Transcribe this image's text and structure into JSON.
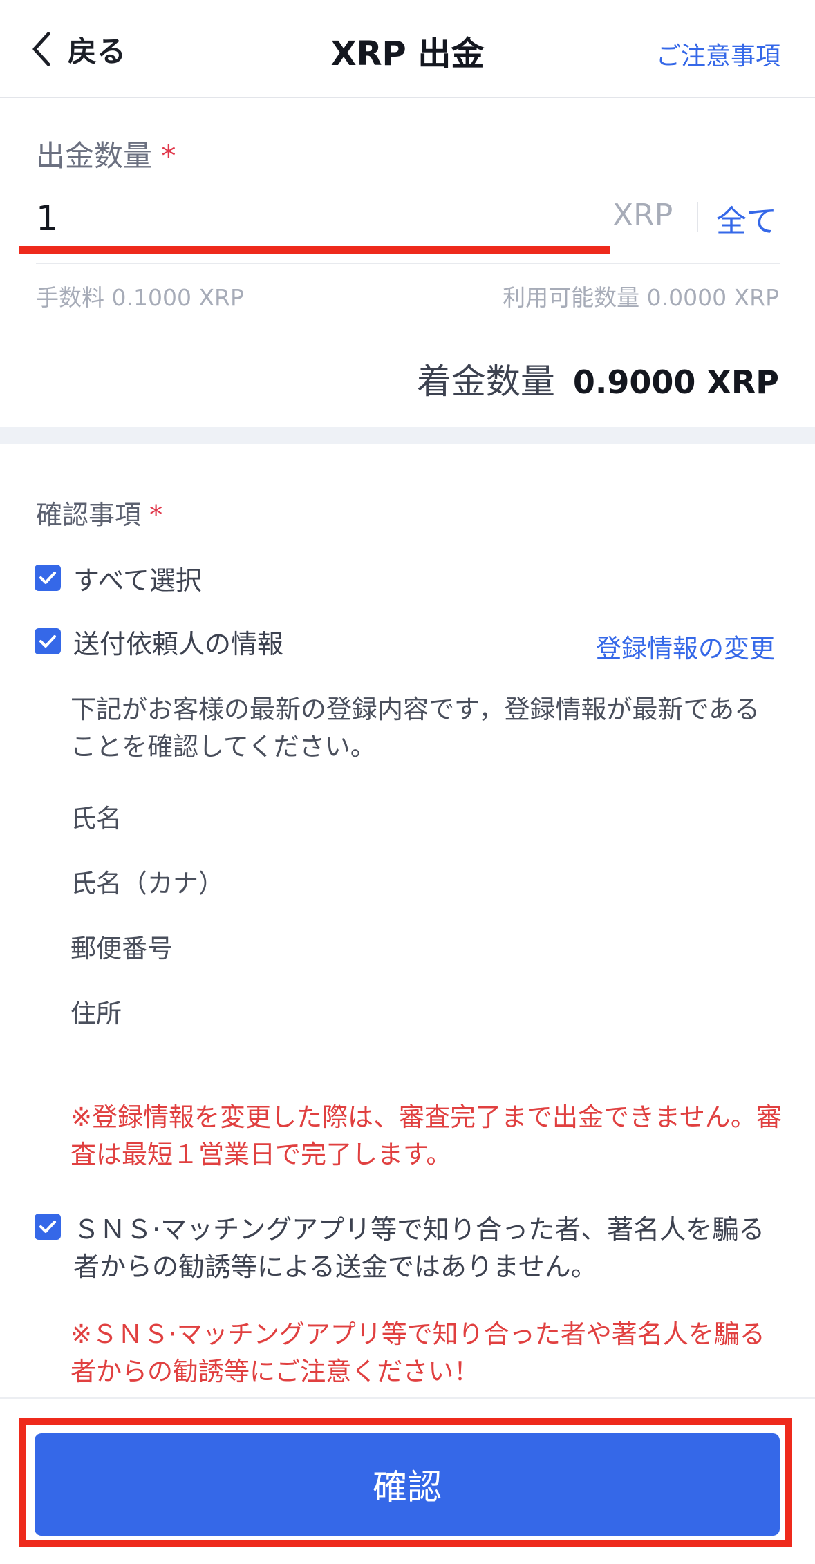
{
  "header": {
    "back_label": "戻る",
    "title": "XRP 出金",
    "notice_link": "ご注意事項"
  },
  "amount": {
    "label": "出金数量",
    "required_mark": "*",
    "value": "1",
    "unit": "XRP",
    "all_button": "全て",
    "fee": "手数料 0.1000 XRP",
    "available": "利用可能数量 0.0000 XRP",
    "receive_label": "着金数量",
    "receive_value": "0.9000 XRP"
  },
  "confirmation": {
    "label": "確認事項",
    "required_mark": "*",
    "select_all": "すべて選択",
    "sender_info": "送付依頼人の情報",
    "change_link": "登録情報の変更",
    "description": "下記がお客様の最新の登録内容です，登録情報が最新であることを確認してください。",
    "fields": [
      "氏名",
      "氏名（カナ）",
      "郵便番号",
      "住所"
    ],
    "warning_1": "※登録情報を変更した際は、審査完了まで出金できません。審査は最短１営業日で完了します。",
    "sns_check": "ＳＮＳ·マッチングアプリ等で知り合った者、著名人を騙る者からの勧誘等による送金ではありません。",
    "warning_2": "※ＳＮＳ·マッチングアプリ等で知り合った者や著名人を騙る者からの勧誘等にご注意ください！"
  },
  "footer": {
    "confirm_button": "確認"
  },
  "colors": {
    "accent": "#3568e8",
    "warning": "#e04040",
    "highlight": "#ee2a1c"
  }
}
